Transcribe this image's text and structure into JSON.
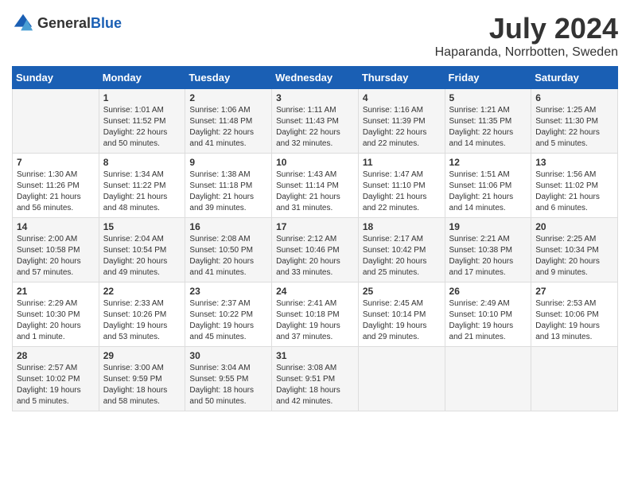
{
  "header": {
    "logo_general": "General",
    "logo_blue": "Blue",
    "month_year": "July 2024",
    "location": "Haparanda, Norrbotten, Sweden"
  },
  "weekdays": [
    "Sunday",
    "Monday",
    "Tuesday",
    "Wednesday",
    "Thursday",
    "Friday",
    "Saturday"
  ],
  "weeks": [
    [
      {
        "day": "",
        "info": ""
      },
      {
        "day": "1",
        "info": "Sunrise: 1:01 AM\nSunset: 11:52 PM\nDaylight: 22 hours\nand 50 minutes."
      },
      {
        "day": "2",
        "info": "Sunrise: 1:06 AM\nSunset: 11:48 PM\nDaylight: 22 hours\nand 41 minutes."
      },
      {
        "day": "3",
        "info": "Sunrise: 1:11 AM\nSunset: 11:43 PM\nDaylight: 22 hours\nand 32 minutes."
      },
      {
        "day": "4",
        "info": "Sunrise: 1:16 AM\nSunset: 11:39 PM\nDaylight: 22 hours\nand 22 minutes."
      },
      {
        "day": "5",
        "info": "Sunrise: 1:21 AM\nSunset: 11:35 PM\nDaylight: 22 hours\nand 14 minutes."
      },
      {
        "day": "6",
        "info": "Sunrise: 1:25 AM\nSunset: 11:30 PM\nDaylight: 22 hours\nand 5 minutes."
      }
    ],
    [
      {
        "day": "7",
        "info": "Sunrise: 1:30 AM\nSunset: 11:26 PM\nDaylight: 21 hours\nand 56 minutes."
      },
      {
        "day": "8",
        "info": "Sunrise: 1:34 AM\nSunset: 11:22 PM\nDaylight: 21 hours\nand 48 minutes."
      },
      {
        "day": "9",
        "info": "Sunrise: 1:38 AM\nSunset: 11:18 PM\nDaylight: 21 hours\nand 39 minutes."
      },
      {
        "day": "10",
        "info": "Sunrise: 1:43 AM\nSunset: 11:14 PM\nDaylight: 21 hours\nand 31 minutes."
      },
      {
        "day": "11",
        "info": "Sunrise: 1:47 AM\nSunset: 11:10 PM\nDaylight: 21 hours\nand 22 minutes."
      },
      {
        "day": "12",
        "info": "Sunrise: 1:51 AM\nSunset: 11:06 PM\nDaylight: 21 hours\nand 14 minutes."
      },
      {
        "day": "13",
        "info": "Sunrise: 1:56 AM\nSunset: 11:02 PM\nDaylight: 21 hours\nand 6 minutes."
      }
    ],
    [
      {
        "day": "14",
        "info": "Sunrise: 2:00 AM\nSunset: 10:58 PM\nDaylight: 20 hours\nand 57 minutes."
      },
      {
        "day": "15",
        "info": "Sunrise: 2:04 AM\nSunset: 10:54 PM\nDaylight: 20 hours\nand 49 minutes."
      },
      {
        "day": "16",
        "info": "Sunrise: 2:08 AM\nSunset: 10:50 PM\nDaylight: 20 hours\nand 41 minutes."
      },
      {
        "day": "17",
        "info": "Sunrise: 2:12 AM\nSunset: 10:46 PM\nDaylight: 20 hours\nand 33 minutes."
      },
      {
        "day": "18",
        "info": "Sunrise: 2:17 AM\nSunset: 10:42 PM\nDaylight: 20 hours\nand 25 minutes."
      },
      {
        "day": "19",
        "info": "Sunrise: 2:21 AM\nSunset: 10:38 PM\nDaylight: 20 hours\nand 17 minutes."
      },
      {
        "day": "20",
        "info": "Sunrise: 2:25 AM\nSunset: 10:34 PM\nDaylight: 20 hours\nand 9 minutes."
      }
    ],
    [
      {
        "day": "21",
        "info": "Sunrise: 2:29 AM\nSunset: 10:30 PM\nDaylight: 20 hours\nand 1 minute."
      },
      {
        "day": "22",
        "info": "Sunrise: 2:33 AM\nSunset: 10:26 PM\nDaylight: 19 hours\nand 53 minutes."
      },
      {
        "day": "23",
        "info": "Sunrise: 2:37 AM\nSunset: 10:22 PM\nDaylight: 19 hours\nand 45 minutes."
      },
      {
        "day": "24",
        "info": "Sunrise: 2:41 AM\nSunset: 10:18 PM\nDaylight: 19 hours\nand 37 minutes."
      },
      {
        "day": "25",
        "info": "Sunrise: 2:45 AM\nSunset: 10:14 PM\nDaylight: 19 hours\nand 29 minutes."
      },
      {
        "day": "26",
        "info": "Sunrise: 2:49 AM\nSunset: 10:10 PM\nDaylight: 19 hours\nand 21 minutes."
      },
      {
        "day": "27",
        "info": "Sunrise: 2:53 AM\nSunset: 10:06 PM\nDaylight: 19 hours\nand 13 minutes."
      }
    ],
    [
      {
        "day": "28",
        "info": "Sunrise: 2:57 AM\nSunset: 10:02 PM\nDaylight: 19 hours\nand 5 minutes."
      },
      {
        "day": "29",
        "info": "Sunrise: 3:00 AM\nSunset: 9:59 PM\nDaylight: 18 hours\nand 58 minutes."
      },
      {
        "day": "30",
        "info": "Sunrise: 3:04 AM\nSunset: 9:55 PM\nDaylight: 18 hours\nand 50 minutes."
      },
      {
        "day": "31",
        "info": "Sunrise: 3:08 AM\nSunset: 9:51 PM\nDaylight: 18 hours\nand 42 minutes."
      },
      {
        "day": "",
        "info": ""
      },
      {
        "day": "",
        "info": ""
      },
      {
        "day": "",
        "info": ""
      }
    ]
  ]
}
